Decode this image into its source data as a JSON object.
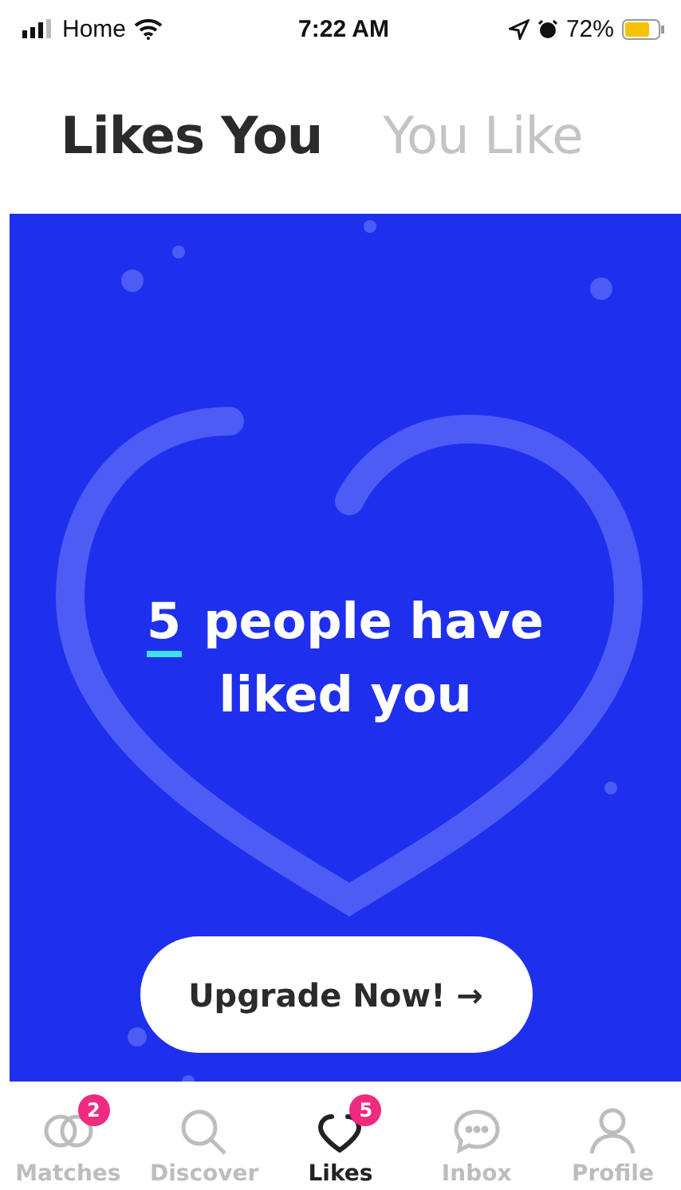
{
  "status_bar": {
    "carrier": "Home",
    "time": "7:22 AM",
    "battery": "72%"
  },
  "tabs": [
    {
      "label": "Likes You",
      "selected": true
    },
    {
      "label": "You Like",
      "selected": false
    }
  ],
  "promo": {
    "count": "5",
    "text": "people have liked you",
    "button": "Upgrade Now! →"
  },
  "nav": [
    {
      "kind": "matches",
      "label": "Matches",
      "selected": false,
      "badge": "2"
    },
    {
      "kind": "discover",
      "label": "Discover",
      "selected": false
    },
    {
      "kind": "likes",
      "label": "Likes",
      "selected": true,
      "badge": "5"
    },
    {
      "kind": "inbox",
      "label": "Inbox",
      "selected": false
    },
    {
      "kind": "profile",
      "label": "Profile",
      "selected": false
    }
  ]
}
